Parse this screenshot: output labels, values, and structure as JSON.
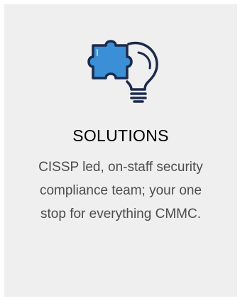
{
  "card": {
    "title": "SOLUTIONS",
    "description": "CISSP led, on-staff security compliance team; your one stop for everything CMMC.",
    "icon": "puzzle-lightbulb-icon"
  },
  "colors": {
    "card_background": "#efefef",
    "icon_stroke": "#1c2a4b",
    "icon_fill": "#3b8fd6",
    "title_text": "#000000",
    "body_text": "#4d4d4d"
  }
}
